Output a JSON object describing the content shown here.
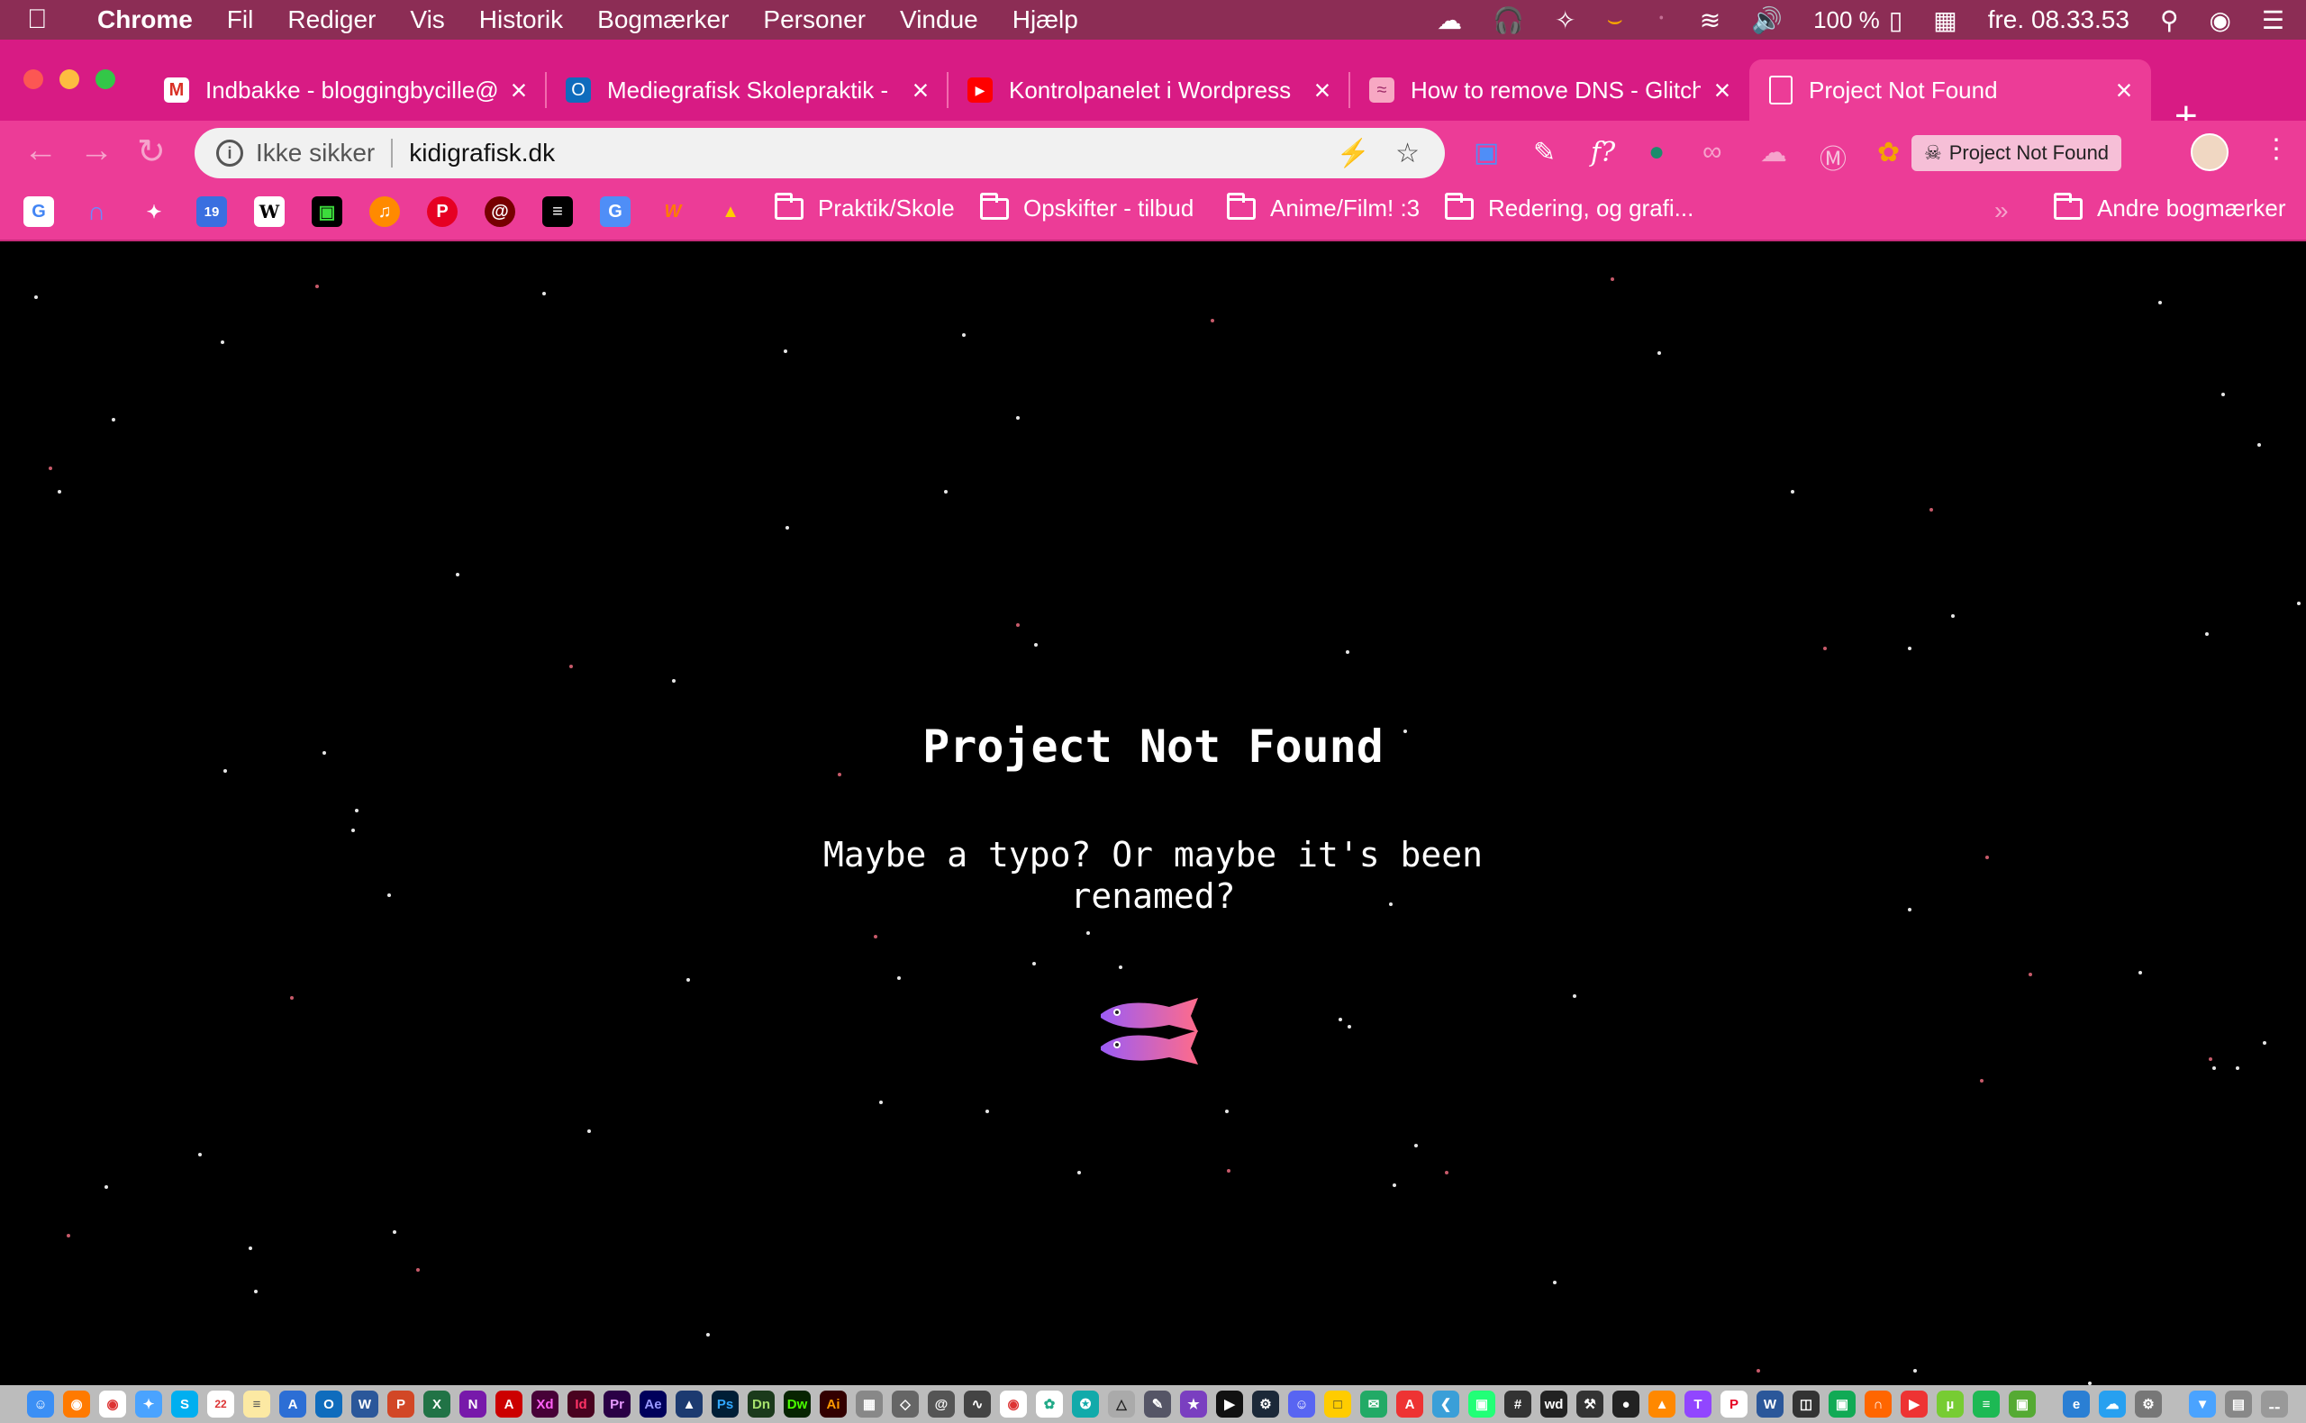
{
  "menubar": {
    "app_name": "Chrome",
    "menus": [
      "Fil",
      "Rediger",
      "Vis",
      "Historik",
      "Bogmærker",
      "Personer",
      "Vindue",
      "Hjælp"
    ],
    "battery": "100 %",
    "clock": "fre. 08.33.53"
  },
  "tabs": [
    {
      "title": "Indbakke - bloggingbycille@",
      "favicon": "gmail-icon",
      "color": "#ffffff"
    },
    {
      "title": "Mediegrafisk Skolepraktik -",
      "favicon": "outlook-icon",
      "color": "#0f6cbd"
    },
    {
      "title": "Kontrolpanelet i Wordpress",
      "favicon": "youtube-icon",
      "color": "#ff0000"
    },
    {
      "title": "How to remove DNS - Glitch",
      "favicon": "glitch-icon",
      "color": "#f7a8c3"
    },
    {
      "title": "Project Not Found",
      "favicon": "page-icon",
      "color": "#ffffff",
      "active": true
    }
  ],
  "omnibox": {
    "security_label": "Ikke sikker",
    "url": "kidigrafisk.dk"
  },
  "extension_chip": "Project Not Found",
  "bookmarks": {
    "folders": [
      "Praktik/Skole",
      "Opskifter - tilbud",
      "Anime/Film! :3",
      "Redering, og grafi..."
    ],
    "other": "Andre bogmærker"
  },
  "page": {
    "title": "Project Not Found",
    "message": "Maybe a typo? Or maybe it's been renamed?"
  },
  "colors": {
    "menubar": "#8c2d55",
    "tabstrip": "#d81b84",
    "toolbar": "#ec3c97",
    "page_bg": "#000000"
  }
}
